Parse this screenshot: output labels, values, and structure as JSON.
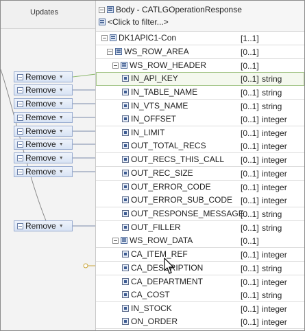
{
  "updates_title": "Updates",
  "tree_header": {
    "title": "Body - CATLGOperationResponse",
    "filter": "<Click to filter...>"
  },
  "rows": [
    {
      "label": "DK1APIC1-Con",
      "card": "[1..1]",
      "type": ""
    },
    {
      "label": "WS_ROW_AREA",
      "card": "[0..1]",
      "type": ""
    },
    {
      "label": "WS_ROW_HEADER",
      "card": "[0..1]",
      "type": ""
    },
    {
      "label": "IN_API_KEY",
      "card": "[0..1]",
      "type": "string"
    },
    {
      "label": "IN_TABLE_NAME",
      "card": "[0..1]",
      "type": "string"
    },
    {
      "label": "IN_VTS_NAME",
      "card": "[0..1]",
      "type": "string"
    },
    {
      "label": "IN_OFFSET",
      "card": "[0..1]",
      "type": "integer"
    },
    {
      "label": "IN_LIMIT",
      "card": "[0..1]",
      "type": "integer"
    },
    {
      "label": "OUT_TOTAL_RECS",
      "card": "[0..1]",
      "type": "integer"
    },
    {
      "label": "OUT_RECS_THIS_CALL",
      "card": "[0..1]",
      "type": "integer"
    },
    {
      "label": "OUT_REC_SIZE",
      "card": "[0..1]",
      "type": "integer"
    },
    {
      "label": "OUT_ERROR_CODE",
      "card": "[0..1]",
      "type": "integer"
    },
    {
      "label": "OUT_ERROR_SUB_CODE",
      "card": "[0..1]",
      "type": "integer"
    },
    {
      "label": "OUT_RESPONSE_MESSAGE",
      "card": "[0..1]",
      "type": "string"
    },
    {
      "label": "OUT_FILLER",
      "card": "[0..1]",
      "type": "string"
    },
    {
      "label": "WS_ROW_DATA",
      "card": "[0..1]",
      "type": ""
    },
    {
      "label": "CA_ITEM_REF",
      "card": "[0..1]",
      "type": "integer"
    },
    {
      "label": "CA_DESCRIPTION",
      "card": "[0..1]",
      "type": "string"
    },
    {
      "label": "CA_DEPARTMENT",
      "card": "[0..1]",
      "type": "integer"
    },
    {
      "label": "CA_COST",
      "card": "[0..1]",
      "type": "string"
    },
    {
      "label": "IN_STOCK",
      "card": "[0..1]",
      "type": "integer"
    },
    {
      "label": "ON_ORDER",
      "card": "[0..1]",
      "type": "integer"
    }
  ],
  "remove_label": "Remove"
}
